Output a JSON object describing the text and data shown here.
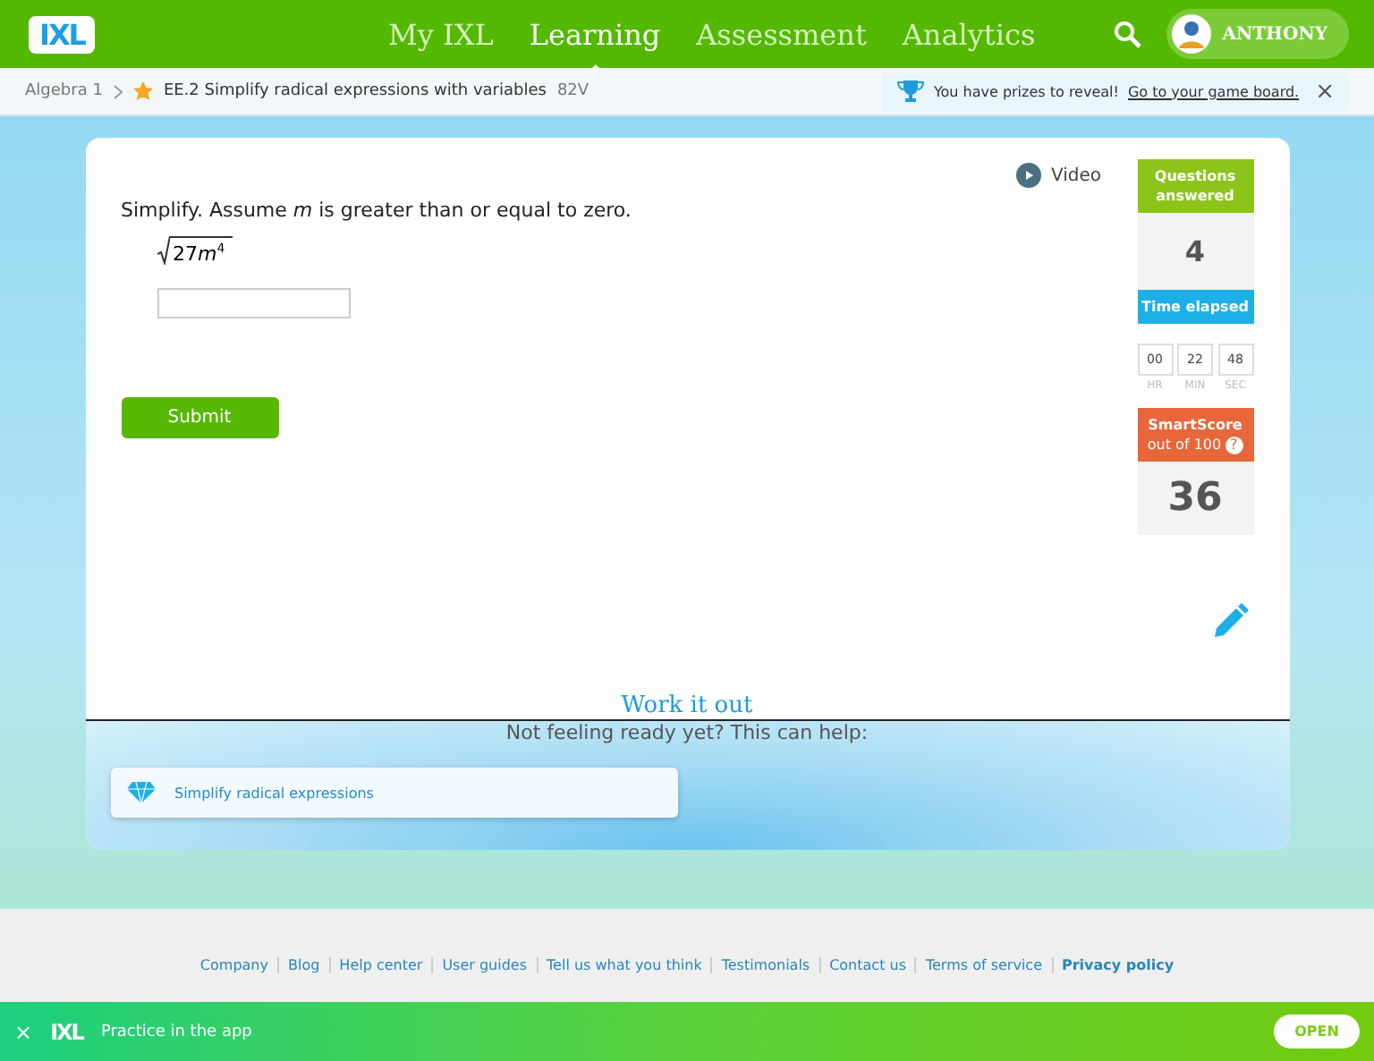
{
  "header": {
    "logo": "IXL",
    "nav": [
      {
        "label": "My IXL",
        "selected": false
      },
      {
        "label": "Learning",
        "selected": true
      },
      {
        "label": "Assessment",
        "selected": false
      },
      {
        "label": "Analytics",
        "selected": false
      }
    ],
    "user": "ANTHONY"
  },
  "breadcrumb": {
    "subject": "Algebra 1",
    "skill": "EE.2 Simplify radical expressions with variables",
    "code": "82V",
    "starred": true
  },
  "prize": {
    "text": "You have prizes to reveal!",
    "link": "Go to your game board.",
    "close": "×"
  },
  "question": {
    "prompt": "Simplify. Assume *m* is greater than or equal to zero.",
    "coefficient": "27",
    "variable": "m",
    "exponent": "4",
    "submit": "Submit"
  },
  "video": "Video",
  "stats": {
    "questions_label": "Questions answered",
    "questions": "4",
    "time_label": "Time elapsed",
    "time": [
      {
        "value": "00",
        "unit": "HR"
      },
      {
        "value": "22",
        "unit": "MIN"
      },
      {
        "value": "48",
        "unit": "SEC"
      }
    ],
    "score_label": "SmartScore",
    "score_sub": "out of 100",
    "score_help": "?",
    "score": "36"
  },
  "work_it_out": "Work it out",
  "help": {
    "heading": "Not feeling ready yet? This can help:",
    "links": [
      "Simplify radical expressions"
    ]
  },
  "footer": {
    "links": [
      {
        "label": "Company",
        "bold": false
      },
      {
        "label": "Blog",
        "bold": false
      },
      {
        "label": "Help center",
        "bold": false
      },
      {
        "label": "User guides",
        "bold": false
      },
      {
        "label": "Tell us what you think",
        "bold": false
      },
      {
        "label": "Testimonials",
        "bold": false
      },
      {
        "label": "Contact us",
        "bold": false
      },
      {
        "label": "Terms of service",
        "bold": false
      },
      {
        "label": "Privacy policy",
        "bold": true
      }
    ]
  },
  "app_banner": {
    "close": "×",
    "logo": "IXL",
    "text": "Practice in the app",
    "button": "OPEN"
  }
}
